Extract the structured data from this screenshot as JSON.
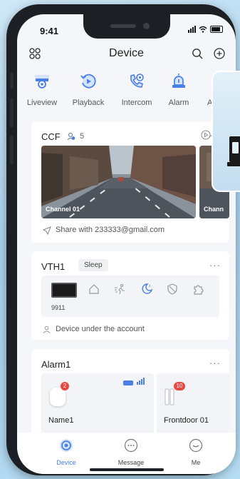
{
  "status": {
    "time": "9:41"
  },
  "header": {
    "title": "Device"
  },
  "quick_actions": [
    {
      "label": "Liveview",
      "icon": "camera-icon"
    },
    {
      "label": "Playback",
      "icon": "playback-icon"
    },
    {
      "label": "Intercom",
      "icon": "intercom-icon"
    },
    {
      "label": "Alarm",
      "icon": "alarm-icon"
    },
    {
      "label": "Acc",
      "icon": "access-icon"
    }
  ],
  "ccf": {
    "title": "CCF",
    "people_count": "5",
    "channels": [
      {
        "label": "Channel 01"
      },
      {
        "label": "Chann"
      }
    ],
    "share_text": "Share with 233333@gmail.com"
  },
  "vth": {
    "title": "VTH1",
    "state": "Sleep",
    "device_number": "9911",
    "account_text": "Device under the account"
  },
  "alarm": {
    "title": "Alarm1",
    "items": [
      {
        "name": "Name1",
        "badge": "2"
      },
      {
        "name": "Frontdoor 01",
        "badge": "10"
      }
    ]
  },
  "nav": [
    {
      "label": "Device",
      "active": true
    },
    {
      "label": "Message",
      "active": false
    },
    {
      "label": "Me",
      "active": false
    }
  ],
  "colors": {
    "accent": "#4a7fe8",
    "badge": "#e8483f",
    "text": "#222222"
  }
}
